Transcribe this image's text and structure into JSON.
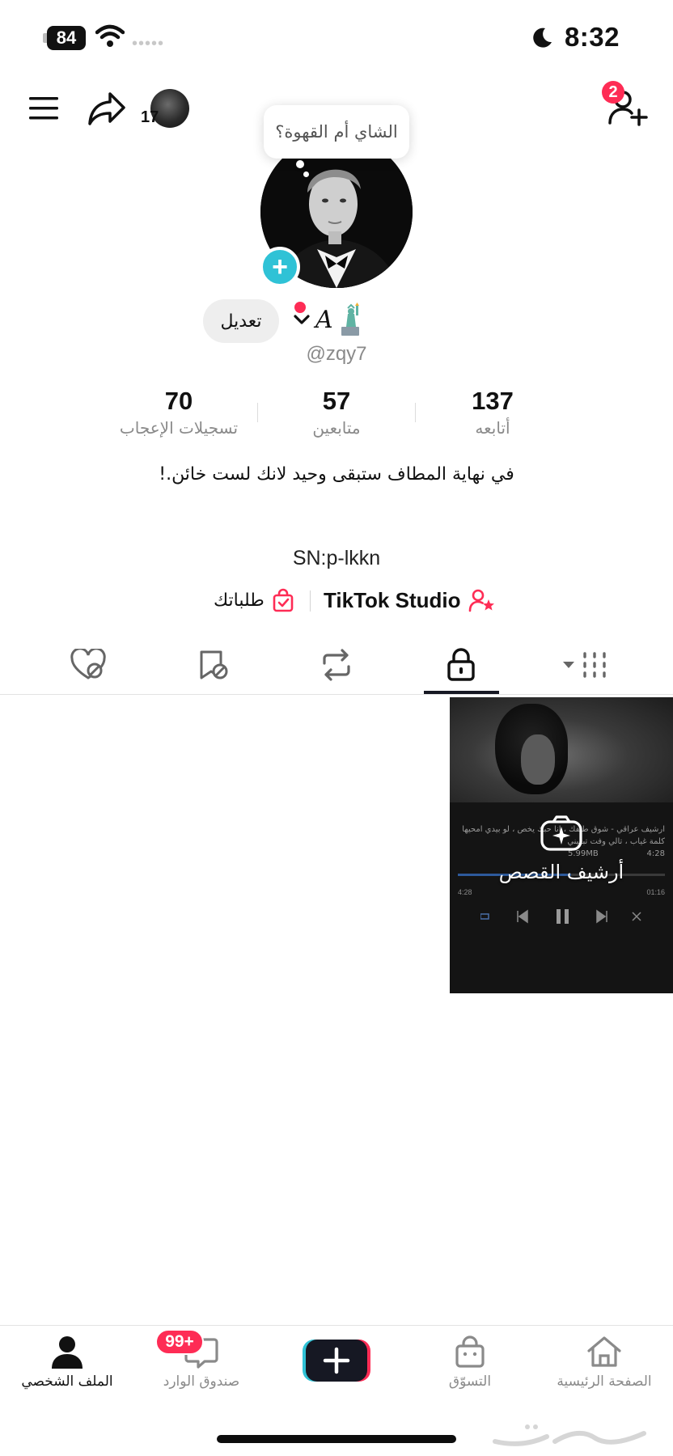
{
  "status_bar": {
    "battery": "84",
    "time": "8:32",
    "dots": "•••••"
  },
  "header": {
    "story_count": "17",
    "add_friends_badge": "2"
  },
  "profile": {
    "note_bubble": "الشاي أم القهوة؟",
    "edit_label": "تعديل",
    "display_name": "A",
    "username": "@zqy7",
    "stats": [
      {
        "value": "137",
        "label": "أتابعه"
      },
      {
        "value": "57",
        "label": "متابعين"
      },
      {
        "value": "70",
        "label": "تسجيلات الإعجاب"
      }
    ],
    "bio": "في نهاية المطاف ستبقى وحيد لانك لست خائن.!",
    "sn": "SN:p-lkkn",
    "studio_label": "TikTok Studio",
    "orders_label": "طلباتك"
  },
  "tabs": [
    {
      "name": "videos",
      "icon": "grid-icon"
    },
    {
      "name": "private",
      "icon": "lock-icon"
    },
    {
      "name": "reposts",
      "icon": "repost-icon"
    },
    {
      "name": "favorites",
      "icon": "bookmark-icon"
    },
    {
      "name": "liked",
      "icon": "heart-icon"
    }
  ],
  "tile": {
    "song_line_1": "ارشيف عراقي - شوق طيفك ، انا حبك يخص ، لو بيدي امحيها",
    "song_line_2": "كلمة غياب ، تالي وفت تبغيني",
    "size": "5.99MB",
    "duration_top": "4:28",
    "time_left": "4:28",
    "time_right": "01:16",
    "archive_label": "أرشيف القصص"
  },
  "bottom_nav": {
    "home": "الصفحة الرئيسية",
    "shop": "التسوّق",
    "inbox": "صندوق الوارد",
    "inbox_badge": "99+",
    "profile": "الملف الشخصي"
  },
  "colors": {
    "accent_red": "#fe2c55",
    "accent_cyan": "#2fc2d6",
    "text_secondary": "#8a8a8a"
  }
}
